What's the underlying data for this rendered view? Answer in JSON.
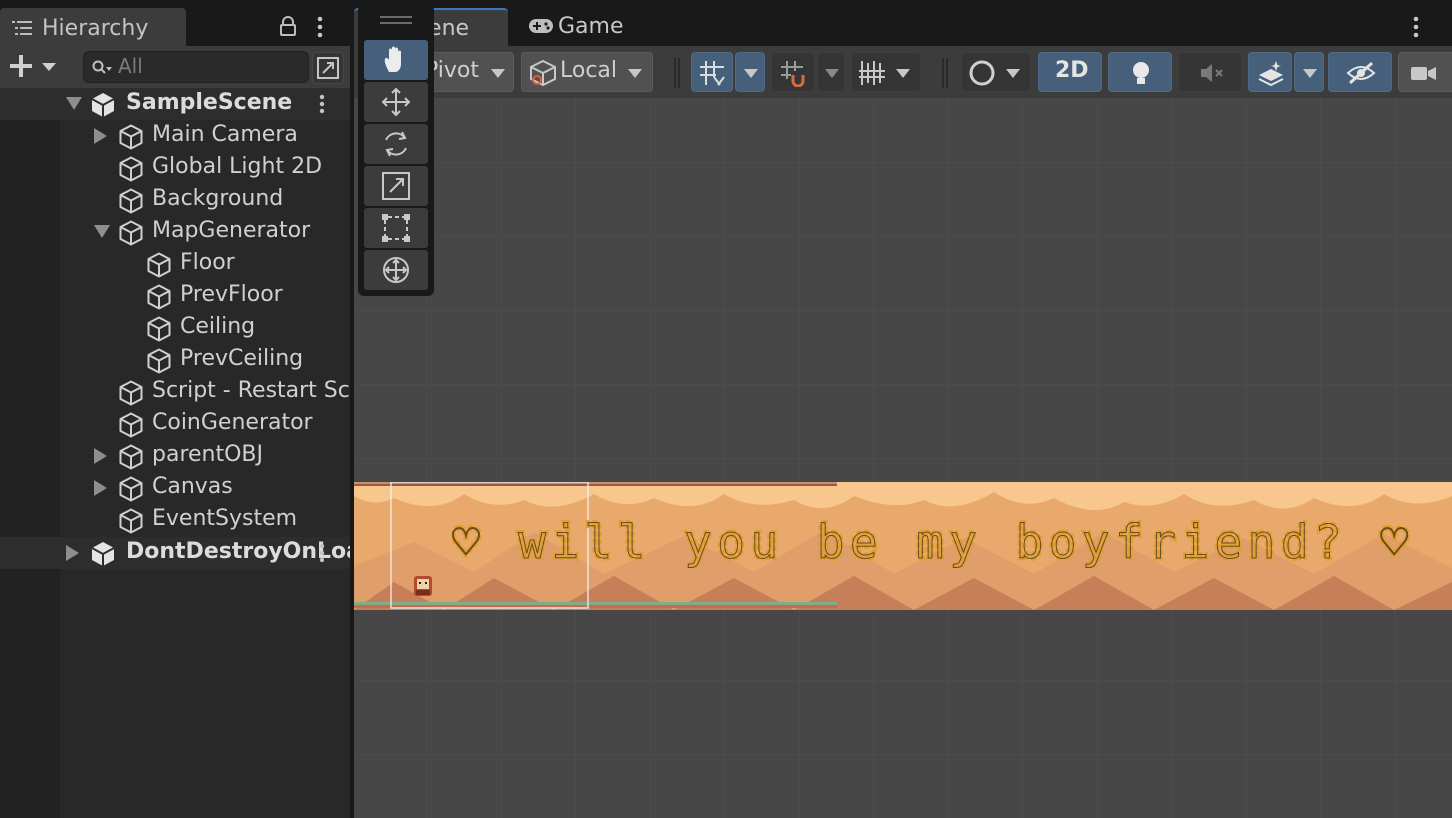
{
  "hierarchy": {
    "tab_label": "Hierarchy",
    "search_placeholder": "All",
    "rows": [
      {
        "label": "SampleScene",
        "kind": "scene",
        "expand": "open"
      },
      {
        "label": "Main Camera",
        "kind": "object",
        "expand": "closed"
      },
      {
        "label": "Global Light 2D",
        "kind": "object",
        "expand": "none"
      },
      {
        "label": "Background",
        "kind": "object",
        "expand": "none"
      },
      {
        "label": "MapGenerator",
        "kind": "object",
        "expand": "open"
      },
      {
        "label": "Floor",
        "kind": "child",
        "expand": "none"
      },
      {
        "label": "PrevFloor",
        "kind": "child",
        "expand": "none"
      },
      {
        "label": "Ceiling",
        "kind": "child",
        "expand": "none"
      },
      {
        "label": "PrevCeiling",
        "kind": "child",
        "expand": "none"
      },
      {
        "label": "Script - Restart Scene",
        "kind": "object",
        "expand": "none"
      },
      {
        "label": "CoinGenerator",
        "kind": "object",
        "expand": "none"
      },
      {
        "label": "parentOBJ",
        "kind": "object",
        "expand": "closed"
      },
      {
        "label": "Canvas",
        "kind": "object",
        "expand": "closed"
      },
      {
        "label": "EventSystem",
        "kind": "object",
        "expand": "none"
      },
      {
        "label": "DontDestroyOnLoad",
        "kind": "scene",
        "expand": "closed"
      }
    ]
  },
  "scene_view": {
    "tabs": [
      {
        "label": "Scene",
        "icon": "hash-icon",
        "active": true
      },
      {
        "label": "Game",
        "icon": "gamepad-icon",
        "active": false
      }
    ],
    "toolbar": {
      "pivot_label": "Pivot",
      "local_label": "Local",
      "mode_2d_label": "2D",
      "mode_2d_active": true,
      "lighting_active": true,
      "effects_active": true,
      "visibility_active": true
    },
    "tools": [
      "hand-tool-icon",
      "move-tool-icon",
      "rotate-tool-icon",
      "scale-tool-icon",
      "rect-tool-icon",
      "transform-tool-icon"
    ],
    "active_tool": "hand-tool-icon",
    "level_message": "♡ will you be my boyfriend? ♡",
    "colors": {
      "accent": "#46607c",
      "level_sand": "#e7a86b",
      "level_wave": "#f7c98f",
      "level_mountain": "#c17b58",
      "coin": "#e0a030"
    }
  }
}
